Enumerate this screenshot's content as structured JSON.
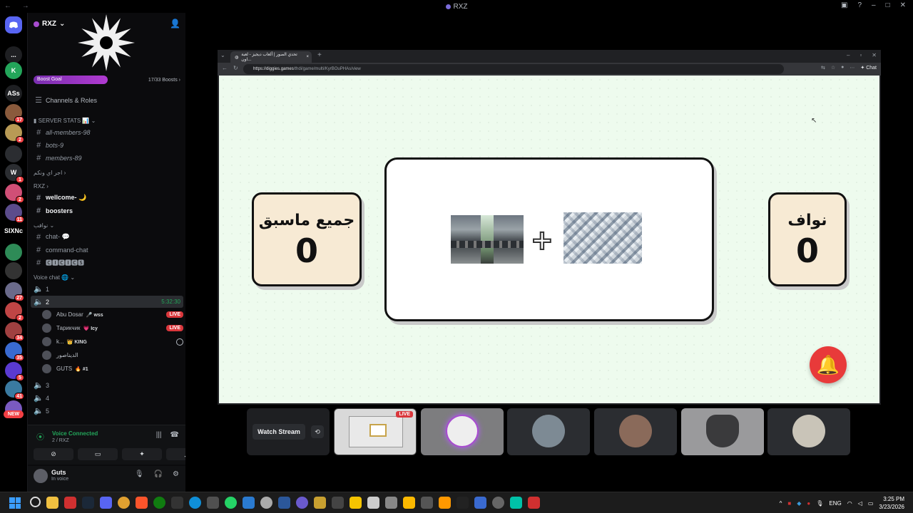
{
  "window": {
    "title": "RXZ"
  },
  "server": {
    "name": "RXZ",
    "boost_label": "Boost Goal",
    "boost_count": "17/33 Boosts",
    "boost_progress": 0.515,
    "channels_roles": "Channels & Roles"
  },
  "rail": {
    "items": [
      {
        "label": "...",
        "color": "#1e1f22"
      },
      {
        "label": "K",
        "color": "#23a55a"
      },
      {
        "label": "ASs",
        "color": "#1e1f22"
      },
      {
        "label": "",
        "color": "#8a5a3c",
        "badge": "17"
      },
      {
        "label": "",
        "color": "#b89a55",
        "badge": "2"
      },
      {
        "label": "",
        "color": "#2b2d31"
      },
      {
        "label": "W",
        "color": "#2b2d31",
        "badge": "1"
      },
      {
        "label": "",
        "color": "#d04f76",
        "badge": "2"
      },
      {
        "label": "",
        "color": "#5b4c8c",
        "badge": "11"
      },
      {
        "label": "SIXNc",
        "color": "#000000"
      },
      {
        "label": "",
        "color": "#2e8b57"
      },
      {
        "label": "",
        "color": "#333333"
      },
      {
        "label": "",
        "color": "#6a6a8a",
        "badge": "27"
      },
      {
        "label": "",
        "color": "#c04545",
        "badge": "2"
      },
      {
        "label": "",
        "color": "#a04040",
        "badge": "34"
      },
      {
        "label": "",
        "color": "#3a6ad0",
        "badge": "35"
      },
      {
        "label": "",
        "color": "#5a3ad0",
        "badge": "5"
      },
      {
        "label": "",
        "color": "#3a7aa0",
        "badge": "41"
      },
      {
        "label": "",
        "color": "#7a5ac0"
      }
    ],
    "new_label": "NEW"
  },
  "channels": {
    "server_stats_cat": "SERVER STATS 📊",
    "all_members": "all-members-98",
    "bots": "bots-9",
    "members": "members-89",
    "cat_arabic": "اجر اي ونكم",
    "cat_rxz": "RXZ",
    "wellcome": "wellcome- 🌙",
    "boosters": "boosters",
    "cat_nawaf": "نوافب",
    "chat": "chat- 💬",
    "command_chat": "command-chat",
    "boxed": "🅲🅸🅲🅸🅲🆂",
    "voice_cat": "Voice chat 🌐",
    "v1": "1",
    "v2": "2",
    "v2_time": "5:32:30",
    "v3": "3",
    "v4": "4",
    "v5": "5"
  },
  "voice_users": [
    {
      "name": "Abu Dosar",
      "tag": "🎤 wss",
      "live": "LIVE"
    },
    {
      "name": "Тарикчик",
      "tag": "💗 Icy",
      "live": "LIVE"
    },
    {
      "name": "k...",
      "tag": "👑 KING",
      "live": ""
    },
    {
      "name": "الديناصور",
      "tag": "",
      "live": ""
    },
    {
      "name": "GUTS",
      "tag": "🔥 #1",
      "live": ""
    }
  ],
  "voice_panel": {
    "status": "Voice Connected",
    "location": "2 / RXZ"
  },
  "user": {
    "name": "Guts",
    "status": "In voice"
  },
  "browser": {
    "tab_title": "تحدي الصور | ألعاب ديجيز - لعبة اون...",
    "url_host": "https://diggies.games",
    "url_path": "/thdi/game/multi/KyrBOuPHAs/view",
    "chat_label": "Chat"
  },
  "game": {
    "left_player": "جميع ماسبق",
    "left_score": "0",
    "right_player": "نواف",
    "right_score": "0",
    "plus": "+"
  },
  "stream": {
    "watch_label": "Watch Stream",
    "live_label": "LIVE"
  },
  "taskbar": {
    "lang": "ENG",
    "time": "3:25 PM",
    "date": "3/23/2026"
  },
  "colors": {
    "discord_bg": "#0b0b0d",
    "accent_green": "#23a55a",
    "live_red": "#da373c",
    "game_bg": "#eefbee",
    "score_box": "#f7ead4",
    "bell": "#e83a3a"
  }
}
